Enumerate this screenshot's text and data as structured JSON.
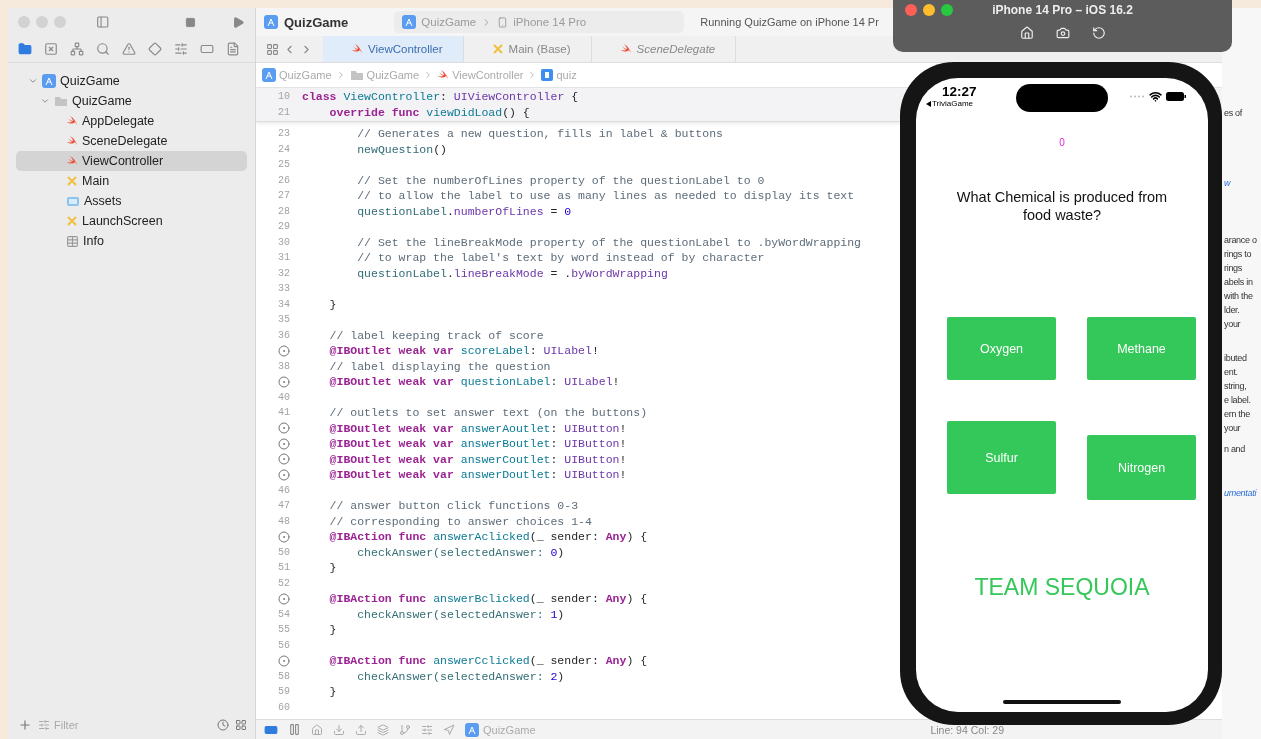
{
  "xcode": {
    "project_title": "QuizGame",
    "scheme": {
      "project": "QuizGame",
      "device": "iPhone 14 Pro"
    },
    "activity": "Running QuizGame on iPhone 14 Pr",
    "navigator": {
      "tree": [
        {
          "label": "QuizGame",
          "kind": "project",
          "expanded": true,
          "selected": false,
          "children": [
            {
              "label": "QuizGame",
              "kind": "folder",
              "expanded": true,
              "selected": false,
              "children": [
                {
                  "label": "AppDelegate",
                  "kind": "swift",
                  "selected": false
                },
                {
                  "label": "SceneDelegate",
                  "kind": "swift",
                  "selected": false
                },
                {
                  "label": "ViewController",
                  "kind": "swift",
                  "selected": true
                },
                {
                  "label": "Main",
                  "kind": "storyboard",
                  "selected": false
                },
                {
                  "label": "Assets",
                  "kind": "assets",
                  "selected": false
                },
                {
                  "label": "LaunchScreen",
                  "kind": "storyboard",
                  "selected": false
                },
                {
                  "label": "Info",
                  "kind": "plist",
                  "selected": false
                }
              ]
            }
          ]
        }
      ],
      "filter": {
        "placeholder": "Filter"
      }
    },
    "tabs": [
      {
        "label": "ViewController",
        "kind": "swift",
        "selected": true,
        "preview": false
      },
      {
        "label": "Main (Base)",
        "kind": "storyboard",
        "selected": false,
        "preview": false
      },
      {
        "label": "SceneDelegate",
        "kind": "swift",
        "selected": false,
        "preview": true
      }
    ],
    "breadcrumb": [
      {
        "label": "QuizGame",
        "kind": "project"
      },
      {
        "label": "QuizGame",
        "kind": "folder"
      },
      {
        "label": "ViewController",
        "kind": "swift"
      },
      {
        "label": "quiz",
        "kind": "property"
      }
    ],
    "sticky_lines": [
      {
        "kind": "numbered",
        "number": "10",
        "tokens": [
          {
            "kind": "kw",
            "text": "class"
          },
          {
            "kind": "decl",
            "text": " ViewController"
          },
          {
            "kind": "plain",
            "text": ": "
          },
          {
            "kind": "type",
            "text": "UIViewController"
          },
          {
            "kind": "plain",
            "text": " {"
          }
        ]
      },
      {
        "kind": "numbered",
        "number": "21",
        "tokens": [
          {
            "kind": "kw",
            "text": "    override func"
          },
          {
            "kind": "decl",
            "text": " viewDidLoad"
          },
          {
            "kind": "plain",
            "text": "() {"
          }
        ]
      }
    ],
    "code_lines": [
      {
        "kind": "numbered",
        "number": "23",
        "tokens": [
          {
            "kind": "comment",
            "text": "        // Generates a new question, fills in label & buttons"
          }
        ]
      },
      {
        "kind": "numbered",
        "number": "24",
        "tokens": [
          {
            "kind": "call",
            "text": "        newQuestion"
          },
          {
            "kind": "plain",
            "text": "()"
          }
        ]
      },
      {
        "kind": "numbered",
        "number": "25"
      },
      {
        "kind": "numbered",
        "number": "26",
        "tokens": [
          {
            "kind": "comment",
            "text": "        // Set the numberOfLines property of the questionLabel to 0"
          }
        ]
      },
      {
        "kind": "numbered",
        "number": "27",
        "tokens": [
          {
            "kind": "comment",
            "text": "        // to allow the label to use as many lines as needed to display its text"
          }
        ]
      },
      {
        "kind": "numbered",
        "number": "28",
        "tokens": [
          {
            "kind": "call",
            "text": "        questionLabel"
          },
          {
            "kind": "plain",
            "text": "."
          },
          {
            "kind": "sys",
            "text": "numberOfLines"
          },
          {
            "kind": "plain",
            "text": " = "
          },
          {
            "kind": "num",
            "text": "0"
          }
        ]
      },
      {
        "kind": "numbered",
        "number": "29"
      },
      {
        "kind": "numbered",
        "number": "30",
        "tokens": [
          {
            "kind": "comment",
            "text": "        // Set the lineBreakMode property of the questionLabel to .byWordWrapping"
          }
        ]
      },
      {
        "kind": "numbered",
        "number": "31",
        "tokens": [
          {
            "kind": "comment",
            "text": "        // to wrap the label's text by word instead of by character"
          }
        ]
      },
      {
        "kind": "numbered",
        "number": "32",
        "tokens": [
          {
            "kind": "call",
            "text": "        questionLabel"
          },
          {
            "kind": "plain",
            "text": "."
          },
          {
            "kind": "sys",
            "text": "lineBreakMode"
          },
          {
            "kind": "plain",
            "text": " = ."
          },
          {
            "kind": "sys",
            "text": "byWordWrapping"
          }
        ]
      },
      {
        "kind": "numbered",
        "number": "33"
      },
      {
        "kind": "numbered",
        "number": "34",
        "tokens": [
          {
            "kind": "plain",
            "text": "    }"
          }
        ]
      },
      {
        "kind": "numbered",
        "number": "35"
      },
      {
        "kind": "numbered",
        "number": "36",
        "tokens": [
          {
            "kind": "comment",
            "text": "    // label keeping track of score"
          }
        ]
      },
      {
        "kind": "outlet",
        "tokens": [
          {
            "kind": "kw",
            "text": "    @IBOutlet weak var"
          },
          {
            "kind": "decl",
            "text": " scoreLabel"
          },
          {
            "kind": "plain",
            "text": ": "
          },
          {
            "kind": "type",
            "text": "UILabel"
          },
          {
            "kind": "plain",
            "text": "!"
          }
        ]
      },
      {
        "kind": "numbered",
        "number": "38",
        "tokens": [
          {
            "kind": "comment",
            "text": "    // label displaying the question"
          }
        ]
      },
      {
        "kind": "outlet",
        "tokens": [
          {
            "kind": "kw",
            "text": "    @IBOutlet weak var"
          },
          {
            "kind": "decl",
            "text": " questionLabel"
          },
          {
            "kind": "plain",
            "text": ": "
          },
          {
            "kind": "type",
            "text": "UILabel"
          },
          {
            "kind": "plain",
            "text": "!"
          }
        ]
      },
      {
        "kind": "numbered",
        "number": "40"
      },
      {
        "kind": "numbered",
        "number": "41",
        "tokens": [
          {
            "kind": "comment",
            "text": "    // outlets to set answer text (on the buttons)"
          }
        ]
      },
      {
        "kind": "outlet",
        "tokens": [
          {
            "kind": "kw",
            "text": "    @IBOutlet weak var"
          },
          {
            "kind": "decl",
            "text": " answerAoutlet"
          },
          {
            "kind": "plain",
            "text": ": "
          },
          {
            "kind": "type",
            "text": "UIButton"
          },
          {
            "kind": "plain",
            "text": "!"
          }
        ]
      },
      {
        "kind": "outlet",
        "tokens": [
          {
            "kind": "kw",
            "text": "    @IBOutlet weak var"
          },
          {
            "kind": "decl",
            "text": " answerBoutlet"
          },
          {
            "kind": "plain",
            "text": ": "
          },
          {
            "kind": "type",
            "text": "UIButton"
          },
          {
            "kind": "plain",
            "text": "!"
          }
        ]
      },
      {
        "kind": "outlet",
        "tokens": [
          {
            "kind": "kw",
            "text": "    @IBOutlet weak var"
          },
          {
            "kind": "decl",
            "text": " answerCoutlet"
          },
          {
            "kind": "plain",
            "text": ": "
          },
          {
            "kind": "type",
            "text": "UIButton"
          },
          {
            "kind": "plain",
            "text": "!"
          }
        ]
      },
      {
        "kind": "outlet",
        "tokens": [
          {
            "kind": "kw",
            "text": "    @IBOutlet weak var"
          },
          {
            "kind": "decl",
            "text": " answerDoutlet"
          },
          {
            "kind": "plain",
            "text": ": "
          },
          {
            "kind": "type",
            "text": "UIButton"
          },
          {
            "kind": "plain",
            "text": "!"
          }
        ]
      },
      {
        "kind": "numbered",
        "number": "46"
      },
      {
        "kind": "numbered",
        "number": "47",
        "tokens": [
          {
            "kind": "comment",
            "text": "    // answer button click functions 0-3"
          }
        ]
      },
      {
        "kind": "numbered",
        "number": "48",
        "tokens": [
          {
            "kind": "comment",
            "text": "    // corresponding to answer choices 1-4"
          }
        ]
      },
      {
        "kind": "outlet",
        "tokens": [
          {
            "kind": "kw",
            "text": "    @IBAction func"
          },
          {
            "kind": "decl",
            "text": " answerAclicked"
          },
          {
            "kind": "plain",
            "text": "(_ sender: "
          },
          {
            "kind": "kw",
            "text": "Any"
          },
          {
            "kind": "plain",
            "text": ") {"
          }
        ]
      },
      {
        "kind": "numbered",
        "number": "50",
        "tokens": [
          {
            "kind": "call",
            "text": "        checkAnswer(selectedAnswer:"
          },
          {
            "kind": "num",
            "text": " 0"
          },
          {
            "kind": "plain",
            "text": ")"
          }
        ]
      },
      {
        "kind": "numbered",
        "number": "51",
        "tokens": [
          {
            "kind": "plain",
            "text": "    }"
          }
        ]
      },
      {
        "kind": "numbered",
        "number": "52"
      },
      {
        "kind": "outlet",
        "tokens": [
          {
            "kind": "kw",
            "text": "    @IBAction func"
          },
          {
            "kind": "decl",
            "text": " answerBclicked"
          },
          {
            "kind": "plain",
            "text": "(_ sender: "
          },
          {
            "kind": "kw",
            "text": "Any"
          },
          {
            "kind": "plain",
            "text": ") {"
          }
        ]
      },
      {
        "kind": "numbered",
        "number": "54",
        "tokens": [
          {
            "kind": "call",
            "text": "        checkAnswer(selectedAnswer:"
          },
          {
            "kind": "num",
            "text": " 1"
          },
          {
            "kind": "plain",
            "text": ")"
          }
        ]
      },
      {
        "kind": "numbered",
        "number": "55",
        "tokens": [
          {
            "kind": "plain",
            "text": "    }"
          }
        ]
      },
      {
        "kind": "numbered",
        "number": "56"
      },
      {
        "kind": "outlet",
        "tokens": [
          {
            "kind": "kw",
            "text": "    @IBAction func"
          },
          {
            "kind": "decl",
            "text": " answerCclicked"
          },
          {
            "kind": "plain",
            "text": "(_ sender: "
          },
          {
            "kind": "kw",
            "text": "Any"
          },
          {
            "kind": "plain",
            "text": ") {"
          }
        ]
      },
      {
        "kind": "numbered",
        "number": "58",
        "tokens": [
          {
            "kind": "call",
            "text": "        checkAnswer(selectedAnswer:"
          },
          {
            "kind": "num",
            "text": " 2"
          },
          {
            "kind": "plain",
            "text": ")"
          }
        ]
      },
      {
        "kind": "numbered",
        "number": "59",
        "tokens": [
          {
            "kind": "plain",
            "text": "    }"
          }
        ]
      },
      {
        "kind": "numbered",
        "number": "60"
      }
    ],
    "debug_bar": {
      "target": "QuizGame"
    },
    "cursor": "Line: 94  Col: 29",
    "inspector": [
      {
        "kind": "text",
        "lines": [
          "es of"
        ]
      },
      {
        "kind": "link",
        "lines": [
          "w"
        ]
      },
      {
        "kind": "text",
        "lines": [
          "arance o",
          "rings to",
          "rings",
          "abels in",
          "with the",
          "lder."
        ]
      },
      {
        "kind": "text",
        "lines": [
          "your"
        ]
      },
      {
        "kind": "text",
        "lines": [
          "ibuted",
          "ent.",
          "string,",
          "e label.",
          "ern the",
          "your"
        ]
      },
      {
        "kind": "text",
        "lines": [
          "n and"
        ]
      },
      {
        "kind": "link",
        "lines": [
          "umentati"
        ]
      }
    ]
  },
  "simulator": {
    "title": "iPhone 14 Pro – iOS 16.2",
    "time": "12:27",
    "back_link": "TriviaGame",
    "score": "0",
    "question": "What Chemical is produced from food waste?",
    "answers": [
      "Oxygen",
      "Methane",
      "Sulfur",
      "Nitrogen"
    ],
    "team": "TEAM SEQUOIA"
  }
}
